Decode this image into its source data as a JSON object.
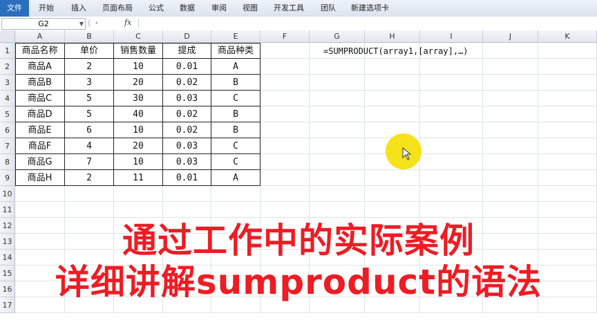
{
  "ribbon": {
    "tabs": [
      "文件",
      "开始",
      "插入",
      "页面布局",
      "公式",
      "数据",
      "审阅",
      "视图",
      "开发工具",
      "团队",
      "新建选项卡"
    ]
  },
  "formula_bar": {
    "name_box": "G2",
    "fx_label": "fx",
    "value": ""
  },
  "sheet": {
    "columns": [
      "A",
      "B",
      "C",
      "D",
      "E",
      "F",
      "G",
      "H",
      "I",
      "J",
      "K"
    ],
    "rows": [
      "1",
      "2",
      "3",
      "4",
      "5",
      "6",
      "7",
      "8",
      "9",
      "10",
      "11",
      "12",
      "13",
      "14",
      "15",
      "16",
      "17"
    ],
    "headers": [
      "商品名称",
      "单价",
      "销售数量",
      "提成",
      "商品种类"
    ],
    "data": [
      [
        "商品A",
        "2",
        "10",
        "0.01",
        "A"
      ],
      [
        "商品B",
        "3",
        "20",
        "0.02",
        "B"
      ],
      [
        "商品C",
        "5",
        "30",
        "0.03",
        "C"
      ],
      [
        "商品D",
        "5",
        "40",
        "0.02",
        "B"
      ],
      [
        "商品E",
        "6",
        "10",
        "0.02",
        "B"
      ],
      [
        "商品F",
        "4",
        "20",
        "0.03",
        "C"
      ],
      [
        "商品G",
        "7",
        "10",
        "0.03",
        "C"
      ],
      [
        "商品H",
        "2",
        "11",
        "0.01",
        "A"
      ]
    ],
    "g1_text": "=SUMPRODUCT(array1,[array],…)"
  },
  "overlay": {
    "line1": "通过工作中的实际案例",
    "line2": "详细讲解sumproduct的语法"
  },
  "colors": {
    "overlay_text": "#ee1c24",
    "cursor_highlight": "#f6e21a",
    "file_tab": "#2a6fbe"
  }
}
